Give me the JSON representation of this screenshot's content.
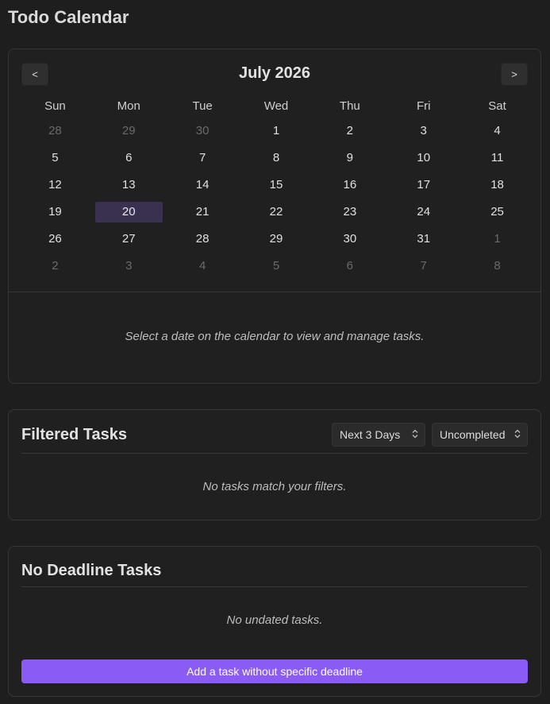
{
  "app": {
    "title": "Todo Calendar"
  },
  "calendar": {
    "month_title": "July 2026",
    "prev_label": "<",
    "next_label": ">",
    "weekdays": [
      "Sun",
      "Mon",
      "Tue",
      "Wed",
      "Thu",
      "Fri",
      "Sat"
    ],
    "weeks": [
      [
        "28",
        "29",
        "30",
        "1",
        "2",
        "3",
        "4"
      ],
      [
        "5",
        "6",
        "7",
        "8",
        "9",
        "10",
        "11"
      ],
      [
        "12",
        "13",
        "14",
        "15",
        "16",
        "17",
        "18"
      ],
      [
        "19",
        "20",
        "21",
        "22",
        "23",
        "24",
        "25"
      ],
      [
        "26",
        "27",
        "28",
        "29",
        "30",
        "31",
        "1"
      ],
      [
        "2",
        "3",
        "4",
        "5",
        "6",
        "7",
        "8"
      ]
    ],
    "hint": "Select a date on the calendar to view and manage tasks."
  },
  "filtered": {
    "title": "Filtered Tasks",
    "range_value": "Next 3 Days",
    "status_value": "Uncompleted",
    "empty": "No tasks match your filters."
  },
  "no_deadline": {
    "title": "No Deadline Tasks",
    "empty": "No undated tasks.",
    "add_label": "Add a task without specific deadline"
  },
  "colors": {
    "accent": "#8a5cf5",
    "today_highlight": "#3a3150",
    "background": "#1e1e1e"
  },
  "icons": {
    "select_chevron": "chevron-up-down-icon"
  }
}
